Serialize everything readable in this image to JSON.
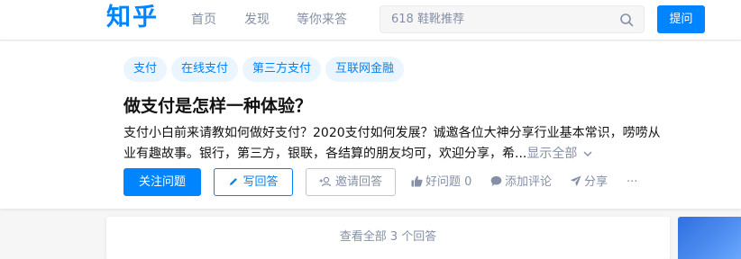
{
  "header": {
    "logo": "知乎",
    "nav": [
      "首页",
      "发现",
      "等你来答"
    ],
    "search_placeholder": "618 鞋靴推荐",
    "ask_label": "提问"
  },
  "question": {
    "tags": [
      "支付",
      "在线支付",
      "第三方支付",
      "互联网金融"
    ],
    "title": "做支付是怎样一种体验？",
    "detail": "支付小白前来请教如何做好支付？2020支付如何发展？诚邀各位大神分享行业基本常识，唠唠从业有趣故事。银行，第三方，银联，各结算的朋友均可，欢迎分享，希...",
    "show_all": "显示全部",
    "actions": {
      "follow": "关注问题",
      "write": "写回答",
      "invite": "邀请回答",
      "good_question": "好问题 0",
      "comment": "添加评论",
      "share": "分享",
      "more": "···"
    }
  },
  "view_all_answers": "查看全部 3 个回答",
  "colors": {
    "brand": "#0084ff",
    "tag_bg": "#ebf5ff",
    "muted": "#8590a6"
  },
  "icons": [
    "search-icon",
    "pencil-icon",
    "invite-icon",
    "thumbs-up-icon",
    "comment-icon",
    "share-icon",
    "more-icon",
    "chevron-down-icon"
  ]
}
